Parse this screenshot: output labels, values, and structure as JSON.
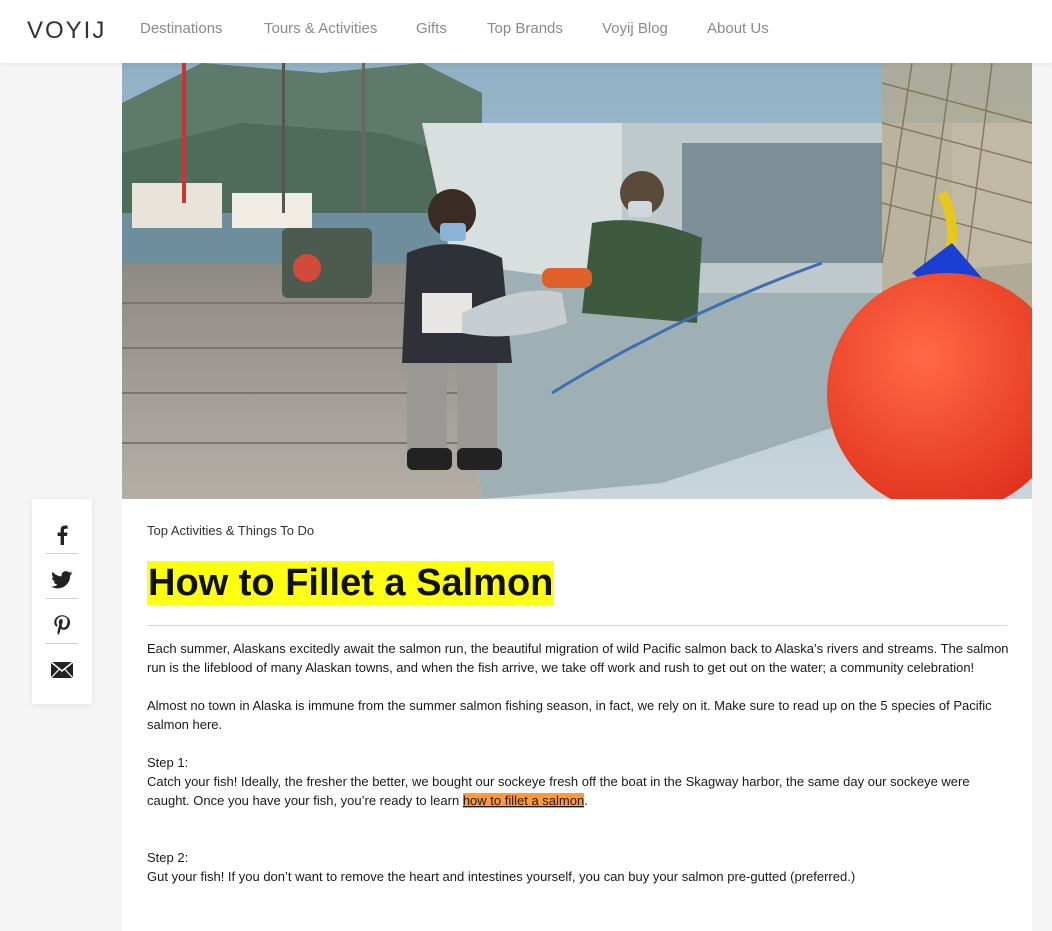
{
  "header": {
    "logo": "VOYIJ",
    "nav": [
      {
        "label": "Destinations"
      },
      {
        "label": "Tours & Activities"
      },
      {
        "label": "Gifts"
      },
      {
        "label": "Top Brands"
      },
      {
        "label": "Voyij Blog"
      },
      {
        "label": "About Us"
      }
    ]
  },
  "article": {
    "category": "Top Activities & Things To Do",
    "title": "How to Fillet a Salmon",
    "paragraphs": {
      "intro": "Each summer, Alaskans excitedly await the salmon run, the beautiful migration of wild Pacific salmon back to Alaska’s rivers and streams. The salmon run is the lifeblood of many Alaskan towns, and when the fish arrive, we take off work and rush to get out on the water; a community celebration!",
      "season": "Almost no town in Alaska is immune from the summer salmon fishing season, in fact, we rely on it. Make sure to read up on the 5 species of Pacific salmon here.",
      "step1_label": "Step 1:",
      "step1_text": "Catch your fish! Ideally, the fresher the better, we bought our sockeye fresh off the boat in the Skagway harbor, the same day our sockeye were caught. Once you have your fish, you’re ready to learn",
      "step1_link": "how to fillet a salmon",
      "step1_end": ".",
      "step2_label": "Step 2:",
      "step2_text": "Gut your fish! If you don’t want to remove the heart and intestines yourself, you can buy your salmon pre-gutted (preferred.)"
    },
    "title_highlight_color": "#ffff12",
    "link_highlight_color": "#ff9a3c"
  },
  "share": {
    "icons": [
      "facebook-icon",
      "twitter-icon",
      "pinterest-icon",
      "email-icon"
    ]
  }
}
